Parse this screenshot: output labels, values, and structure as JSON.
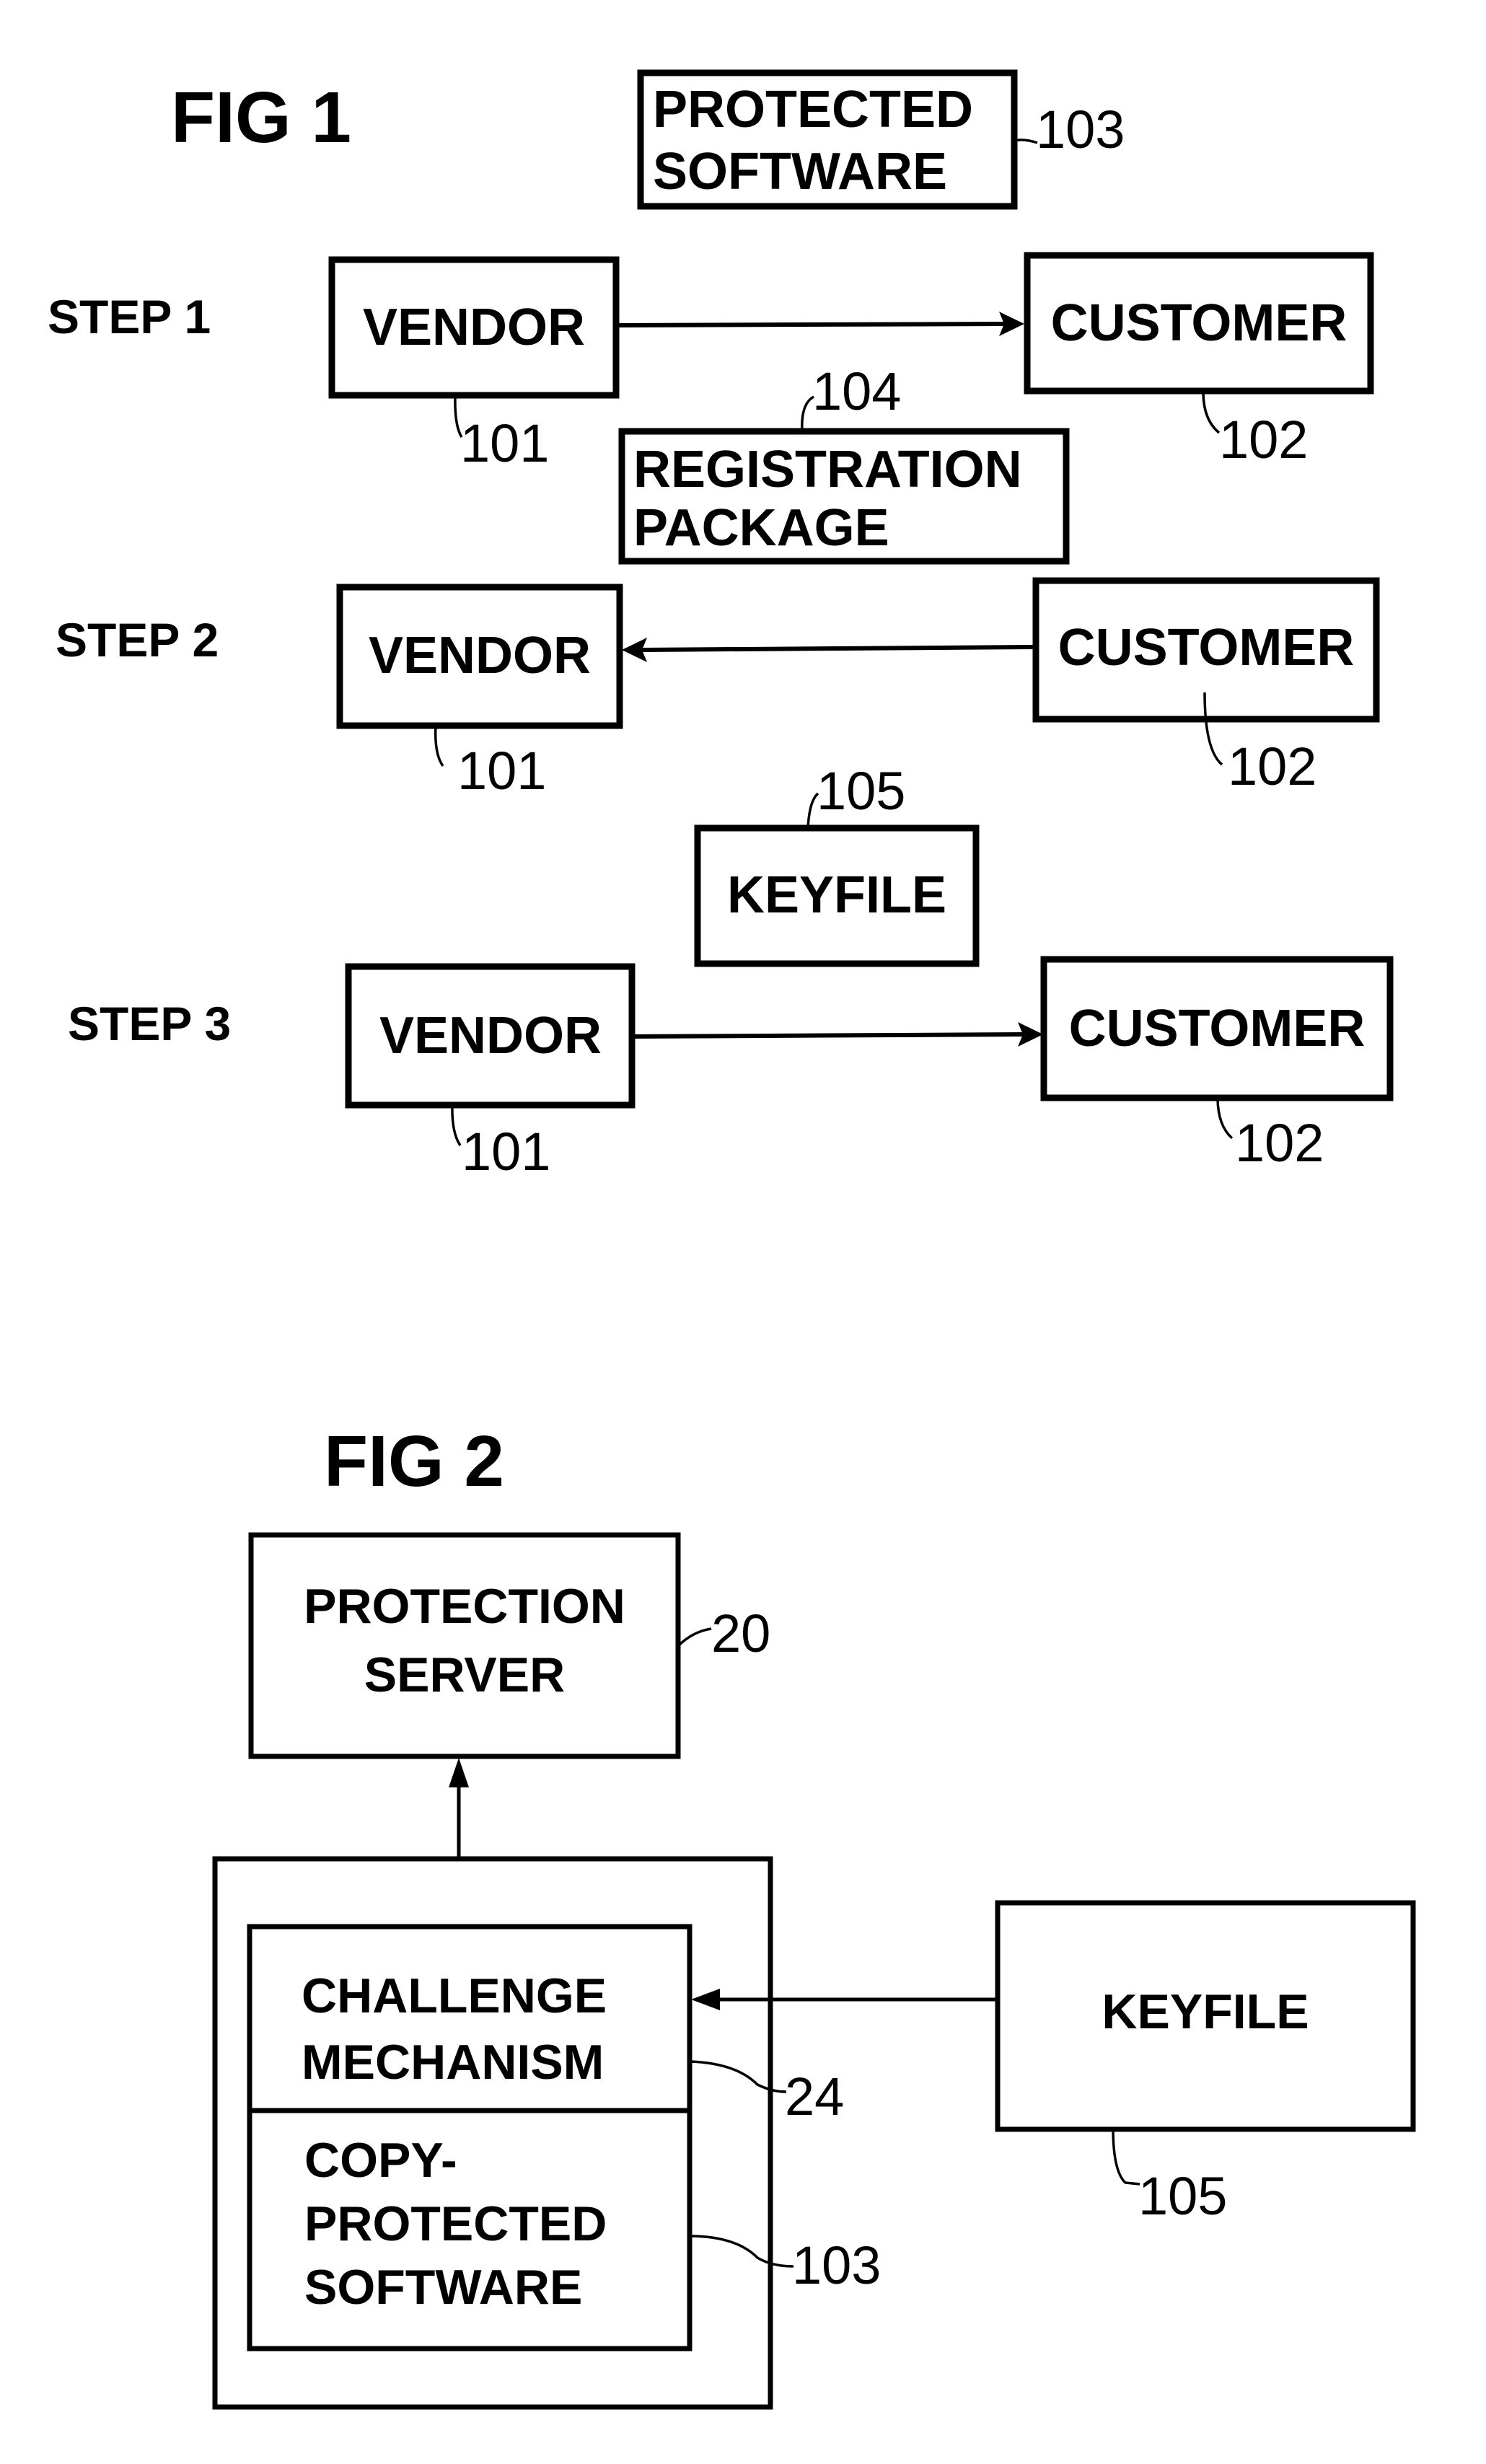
{
  "fig1": {
    "title": "FIG 1",
    "protected_software": {
      "line1": "PROTECTED",
      "line2": "SOFTWARE",
      "ref": "103"
    },
    "registration_package": {
      "line1": "REGISTRATION",
      "line2": "PACKAGE",
      "ref": "104"
    },
    "keyfile": {
      "label": "KEYFILE",
      "ref": "105"
    },
    "steps": [
      {
        "label": "STEP 1",
        "vendor": "VENDOR",
        "vendor_ref": "101",
        "customer": "CUSTOMER",
        "customer_ref": "102",
        "direction": "vendor-to-customer"
      },
      {
        "label": "STEP 2",
        "vendor": "VENDOR",
        "vendor_ref": "101",
        "customer": "CUSTOMER",
        "customer_ref": "102",
        "direction": "customer-to-vendor"
      },
      {
        "label": "STEP 3",
        "vendor": "VENDOR",
        "vendor_ref": "101",
        "customer": "CUSTOMER",
        "customer_ref": "102",
        "direction": "vendor-to-customer"
      }
    ]
  },
  "fig2": {
    "title": "FIG 2",
    "protection_server": {
      "line1": "PROTECTION",
      "line2": "SERVER",
      "ref": "20"
    },
    "challenge_mechanism": {
      "line1": "CHALLENGE",
      "line2": "MECHANISM",
      "ref": "24"
    },
    "copy_protected_software": {
      "line1": "COPY-",
      "line2": "PROTECTED",
      "line3": "SOFTWARE",
      "ref": "103"
    },
    "keyfile": {
      "label": "KEYFILE",
      "ref": "105"
    }
  }
}
